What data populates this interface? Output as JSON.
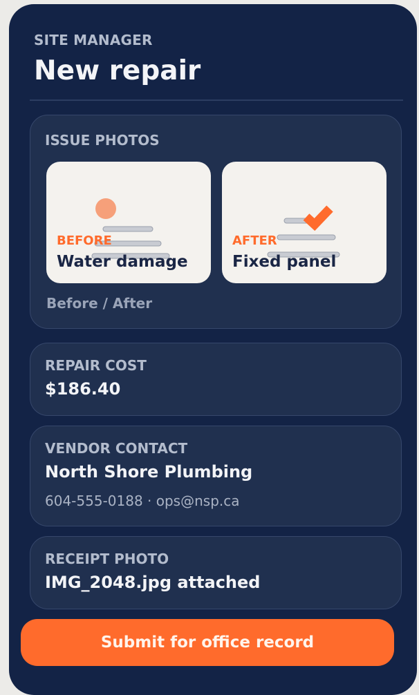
{
  "header": {
    "eyebrow": "SITE MANAGER",
    "title": "New repair"
  },
  "issue_photos": {
    "label": "ISSUE PHOTOS",
    "before": {
      "tag": "BEFORE",
      "caption": "Water damage"
    },
    "after": {
      "tag": "AFTER",
      "caption": "Fixed panel"
    },
    "footer": "Before / After"
  },
  "repair_cost": {
    "label": "REPAIR COST",
    "value": "$186.40"
  },
  "vendor": {
    "label": "VENDOR CONTACT",
    "name": "North Shore Plumbing",
    "contact": "604-555-0188 · ops@nsp.ca"
  },
  "receipt": {
    "label": "RECEIPT PHOTO",
    "value": "IMG_2048.jpg attached"
  },
  "submit_label": "Submit for office record",
  "colors": {
    "background": "#132346",
    "card": "#20304f",
    "accent": "#ff6b2c",
    "photo_bg": "#f4f2ee"
  }
}
